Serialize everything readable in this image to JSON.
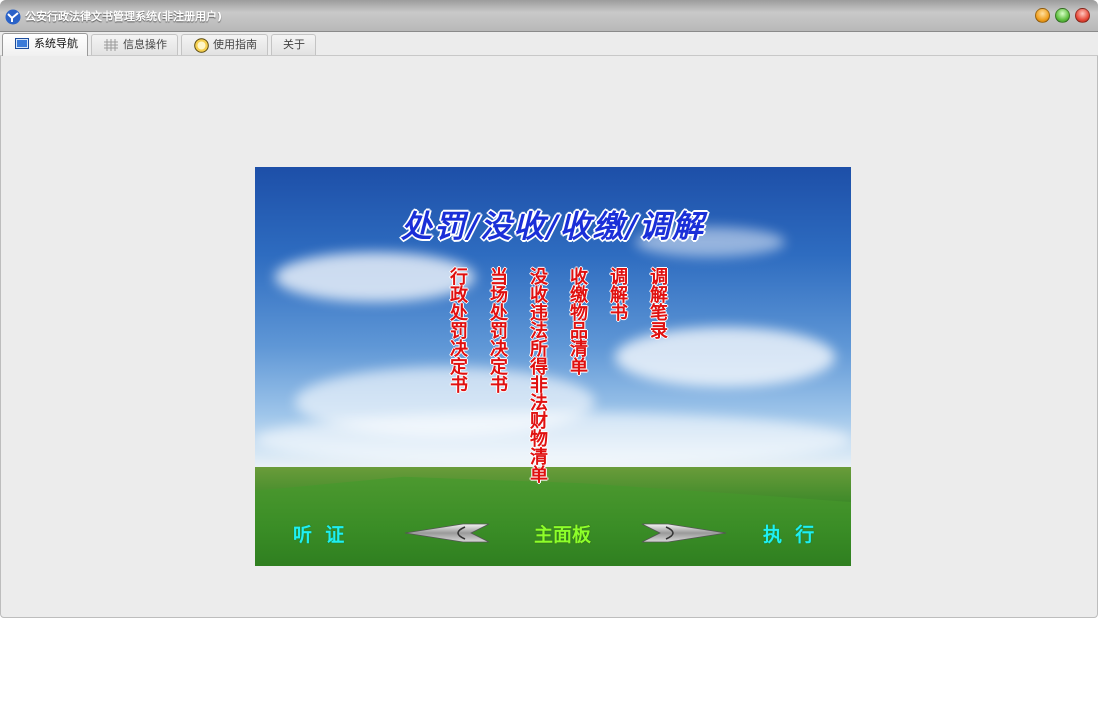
{
  "window": {
    "title": "公安行政法律文书管理系统(非注册用户)"
  },
  "tabs": [
    {
      "label": "系统导航",
      "icon": "monitor-icon",
      "active": true
    },
    {
      "label": "信息操作",
      "icon": "grid-icon",
      "active": false
    },
    {
      "label": "使用指南",
      "icon": "help-globe-icon",
      "active": false
    },
    {
      "label": "关于",
      "icon": "",
      "active": false
    }
  ],
  "panel": {
    "heading": "处罚/没收/收缴/调解",
    "items": [
      "行政处罚决定书",
      "当场处罚决定书",
      "没收违法所得非法财物清单",
      "收缴物品清单",
      "调解书",
      "调解笔录"
    ],
    "nav": {
      "left_label": "听  证",
      "center_label": "主面板",
      "right_label": "执  行",
      "prev_icon": "left-arrow-icon",
      "next_icon": "right-arrow-icon"
    }
  },
  "colors": {
    "heading": "#1a2fd8",
    "item_text": "#e01010",
    "nav_side": "#1ff0f0",
    "nav_center": "#8cff2a"
  }
}
